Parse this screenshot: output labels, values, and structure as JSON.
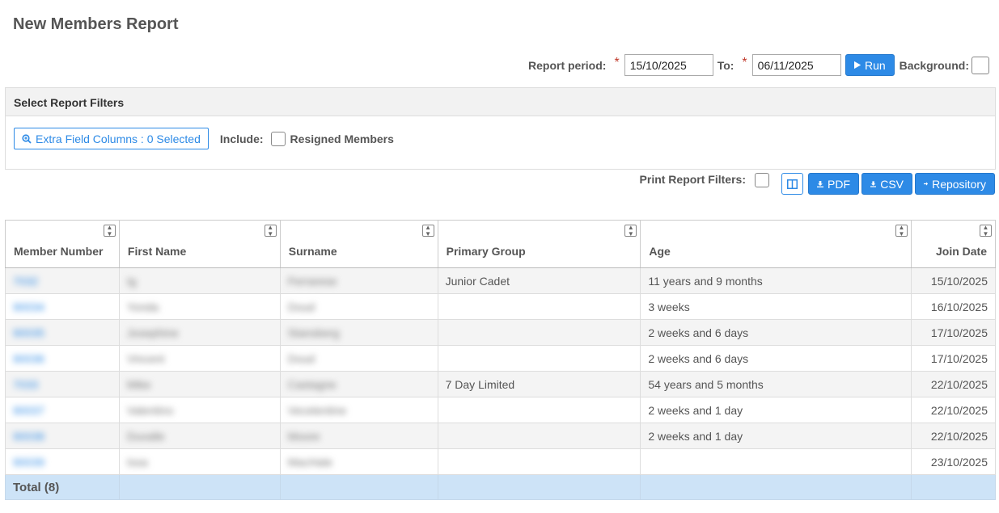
{
  "page": {
    "title": "New Members Report"
  },
  "period": {
    "label": "Report period:",
    "required_mark": "*",
    "from_value": "15/10/2025",
    "to_label": "To:",
    "to_value": "06/11/2025",
    "run_label": "Run",
    "background_label": "Background:"
  },
  "filters": {
    "header": "Select Report Filters",
    "extra_fields_label": "Extra Field Columns : 0 Selected",
    "include_label": "Include:",
    "resigned_label": "Resigned Members"
  },
  "export": {
    "print_filters_label": "Print Report Filters:",
    "pdf_label": "PDF",
    "csv_label": "CSV",
    "repository_label": "Repository"
  },
  "table": {
    "columns": [
      "Member Number",
      "First Name",
      "Surname",
      "Primary Group",
      "Age",
      "Join Date"
    ],
    "rows": [
      {
        "member": "7032",
        "first": "Ig",
        "surname": "Ferrarese",
        "group": "Junior Cadet",
        "age": "11 years and 9 months",
        "join": "15/10/2025"
      },
      {
        "member": "90034",
        "first": "Yonda",
        "surname": "Doud",
        "group": "",
        "age": "3 weeks",
        "join": "16/10/2025"
      },
      {
        "member": "90035",
        "first": "Josephine",
        "surname": "Stansberg",
        "group": "",
        "age": "2 weeks and 6 days",
        "join": "17/10/2025"
      },
      {
        "member": "90036",
        "first": "Vincent",
        "surname": "Doud",
        "group": "",
        "age": "2 weeks and 6 days",
        "join": "17/10/2025"
      },
      {
        "member": "7033",
        "first": "Mike",
        "surname": "Castagne",
        "group": "7 Day Limited",
        "age": "54 years and 5 months",
        "join": "22/10/2025"
      },
      {
        "member": "90037",
        "first": "Valentino",
        "surname": "Vecelentine",
        "group": "",
        "age": "2 weeks and 1 day",
        "join": "22/10/2025"
      },
      {
        "member": "90038",
        "first": "Duvalle",
        "surname": "Moore",
        "group": "",
        "age": "2 weeks and 1 day",
        "join": "22/10/2025"
      },
      {
        "member": "90039",
        "first": "Issa",
        "surname": "MacHale",
        "group": "",
        "age": "",
        "join": "23/10/2025"
      }
    ],
    "total_label": "Total (8)"
  },
  "colors": {
    "accent": "#2d8ae6",
    "total_row": "#cde3f7",
    "alt_row": "#f4f4f4"
  }
}
